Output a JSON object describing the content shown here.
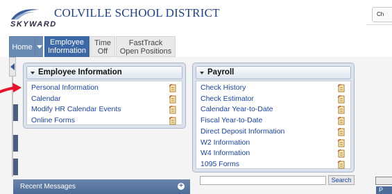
{
  "header": {
    "logo_text": "SKYWARD",
    "district_name": "COLVILLE SCHOOL DISTRICT",
    "chrome_button": "Ch"
  },
  "nav": {
    "home": "Home",
    "tabs": [
      {
        "line1": "Employee",
        "line2": "Information"
      },
      {
        "line1": "Time",
        "line2": "Off"
      },
      {
        "line1": "FastTrack",
        "line2": "Open Positions"
      }
    ]
  },
  "employee_panel": {
    "title": "Employee Information",
    "items": [
      {
        "label": "Personal Information"
      },
      {
        "label": "Calendar"
      },
      {
        "label": "Modify HR Calendar Events"
      },
      {
        "label": "Online Forms"
      }
    ]
  },
  "payroll_panel": {
    "title": "Payroll",
    "items": [
      {
        "label": "Check History"
      },
      {
        "label": "Check Estimator"
      },
      {
        "label": "Calendar Year-to-Date"
      },
      {
        "label": "Fiscal Year-to-Date"
      },
      {
        "label": "Direct Deposit Information"
      },
      {
        "label": "W2 Information"
      },
      {
        "label": "W4 Information"
      },
      {
        "label": "1095 Forms"
      }
    ]
  },
  "lower": {
    "search_label": "Search",
    "search_value": "",
    "recent_messages": "Recent Messages",
    "right_widget_text": "P"
  },
  "colors": {
    "accent": "#3d68a6",
    "link": "#1a43a8",
    "pointer": "#e8112d"
  }
}
